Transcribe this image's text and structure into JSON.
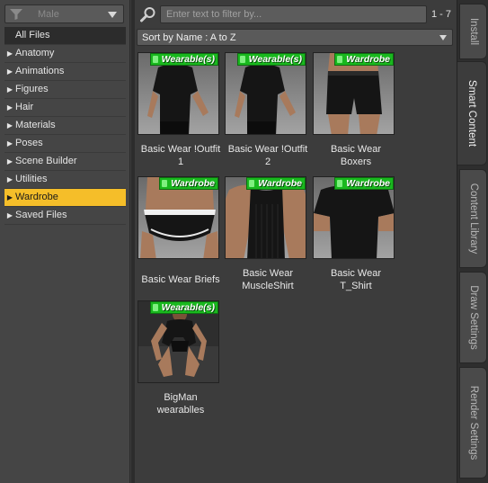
{
  "filter": {
    "selected": "Male",
    "icon": "funnel-icon"
  },
  "categories": [
    {
      "label": "All Files",
      "has_arrow": false,
      "selected": false
    },
    {
      "label": "Anatomy",
      "has_arrow": true,
      "selected": false
    },
    {
      "label": "Animations",
      "has_arrow": true,
      "selected": false
    },
    {
      "label": "Figures",
      "has_arrow": true,
      "selected": false
    },
    {
      "label": "Hair",
      "has_arrow": true,
      "selected": false
    },
    {
      "label": "Materials",
      "has_arrow": true,
      "selected": false
    },
    {
      "label": "Poses",
      "has_arrow": true,
      "selected": false
    },
    {
      "label": "Scene Builder",
      "has_arrow": true,
      "selected": false
    },
    {
      "label": "Utilities",
      "has_arrow": true,
      "selected": false
    },
    {
      "label": "Wardrobe",
      "has_arrow": true,
      "selected": true
    },
    {
      "label": "Saved Files",
      "has_arrow": true,
      "selected": false
    }
  ],
  "search": {
    "placeholder": "Enter text to filter by...",
    "value": "",
    "icon": "search-icon"
  },
  "result_count": "1 - 7",
  "sort": {
    "label": "Sort by Name : A to Z"
  },
  "items": [
    {
      "name_line1": "Basic Wear !Outfit",
      "name_line2": "1",
      "badge": "Wearable(s)",
      "art": "outfit"
    },
    {
      "name_line1": "Basic Wear !Outfit",
      "name_line2": "2",
      "badge": "Wearable(s)",
      "art": "outfit"
    },
    {
      "name_line1": "Basic Wear",
      "name_line2": "Boxers",
      "badge": "Wardrobe",
      "art": "boxers"
    },
    {
      "name_line1": "Basic Wear Briefs",
      "name_line2": "",
      "badge": "Wardrobe",
      "art": "briefs"
    },
    {
      "name_line1": "Basic Wear",
      "name_line2": "MuscleShirt",
      "badge": "Wardrobe",
      "art": "muscleshirt"
    },
    {
      "name_line1": "Basic Wear",
      "name_line2": "T_Shirt",
      "badge": "Wardrobe",
      "art": "tshirt"
    },
    {
      "name_line1": "BigMan",
      "name_line2": "wearablles",
      "badge": "Wearable(s)",
      "art": "figure"
    }
  ],
  "tabs": [
    {
      "label": "Install",
      "active": false
    },
    {
      "label": "Smart Content",
      "active": true
    },
    {
      "label": "Content Library",
      "active": false
    },
    {
      "label": "Draw Settings",
      "active": false
    },
    {
      "label": "Render Settings",
      "active": false
    }
  ],
  "colors": {
    "selected": "#f5be29",
    "badge": "#19b81e",
    "background": "#3c3c3c"
  }
}
